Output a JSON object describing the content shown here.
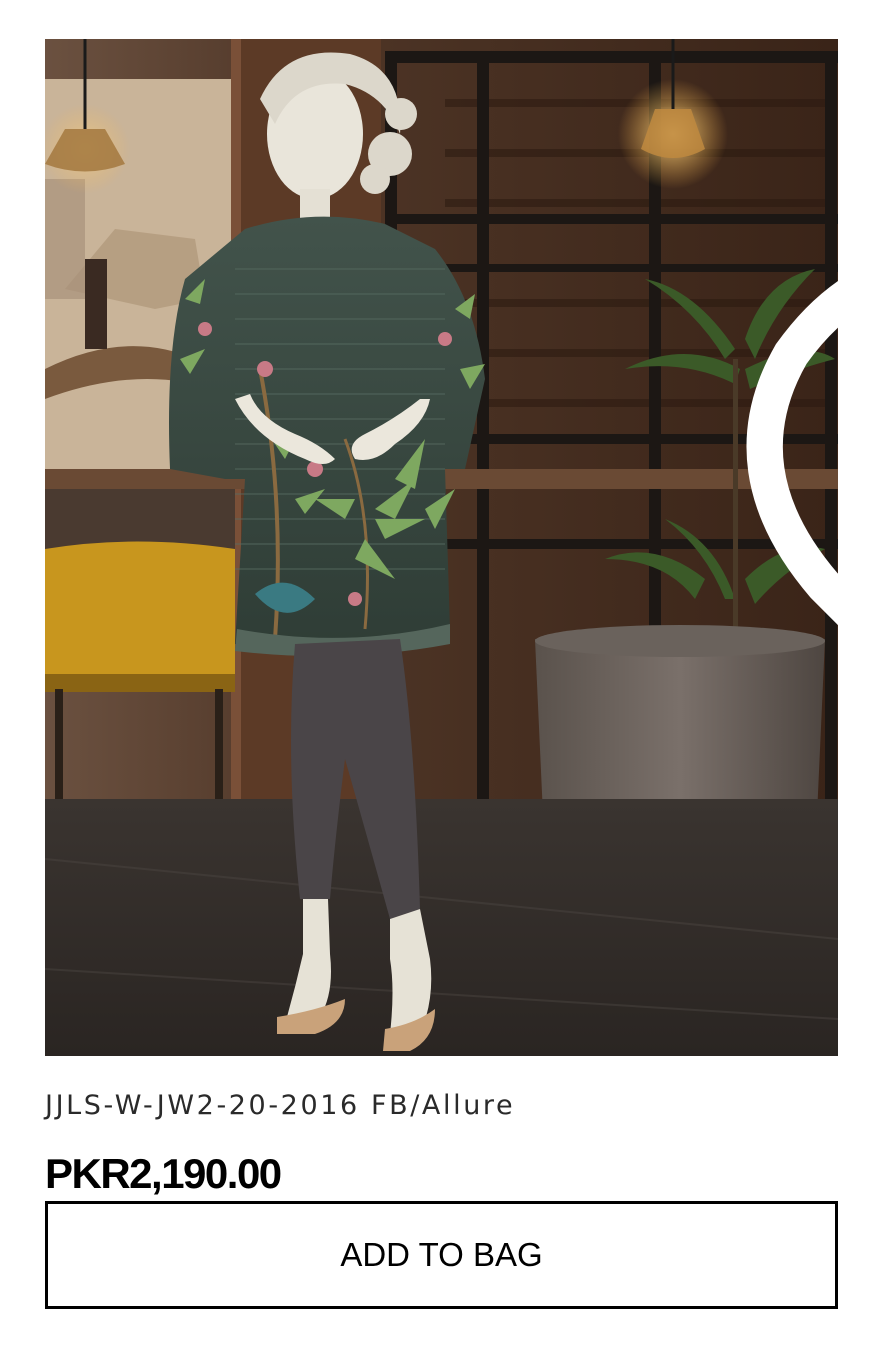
{
  "product": {
    "name": "JJLS-W-JW2-20-2016 FB/Allure",
    "price": "PKR2,190.00",
    "add_to_bag_label": "ADD TO BAG",
    "wishlist_icon": "heart-outline-icon"
  },
  "colors": {
    "button_border": "#000000",
    "name_text": "#2a2a2a",
    "price_text": "#000000",
    "shirt": "#3a4a42",
    "trousers": "#4a4548"
  }
}
